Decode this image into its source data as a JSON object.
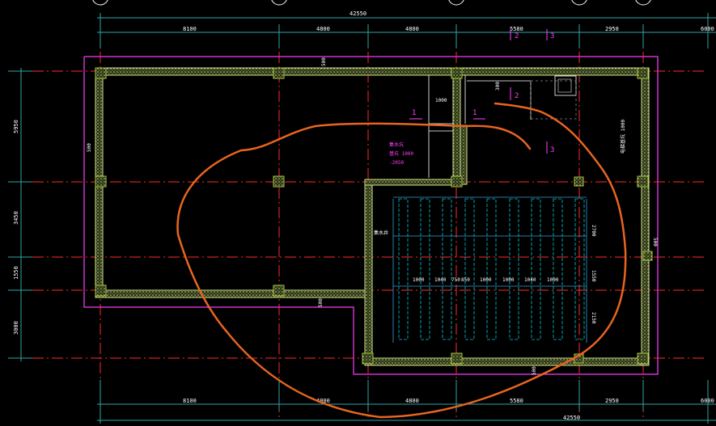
{
  "colors": {
    "background": "#000000",
    "dimension": "#2fa6a6",
    "axis": "#ff2a2a",
    "boundary": "#cc33cc",
    "wall": "#d7e58a",
    "column": "#a9c93c",
    "grid": "#3a9bd6",
    "pit": "#00c8d8",
    "markup": "#e8651f",
    "label": "#ffffff",
    "tag": "#ff40ff"
  },
  "dims": {
    "top_total": "42550",
    "top_spans": [
      "8100",
      "4800",
      "4800",
      "5580",
      "2950",
      "6000"
    ],
    "bottom_total": "42550",
    "bottom_spans": [
      "8100",
      "4800",
      "4800",
      "5580",
      "2950",
      "6000"
    ],
    "left_spans": [
      "5950",
      "3450",
      "1550",
      "3000"
    ],
    "wall_widths": [
      "500",
      "500",
      "500",
      "500",
      "500"
    ],
    "pit_spans": [
      "1000",
      "1040",
      "750",
      "850",
      "1000",
      "1000",
      "1040",
      "1000"
    ],
    "right_spans": [
      "2700",
      "1550",
      "2150"
    ],
    "small_dims": [
      "1000",
      "300"
    ]
  },
  "section_marks": [
    "1",
    "1",
    "2",
    "2",
    "3",
    "3"
  ],
  "annotations": {
    "equipment_label": "集水井",
    "vertical_note": "电梯基坑 1000",
    "pit_note_lines": [
      "集水坑",
      "基坑 1000",
      "-2050"
    ]
  }
}
